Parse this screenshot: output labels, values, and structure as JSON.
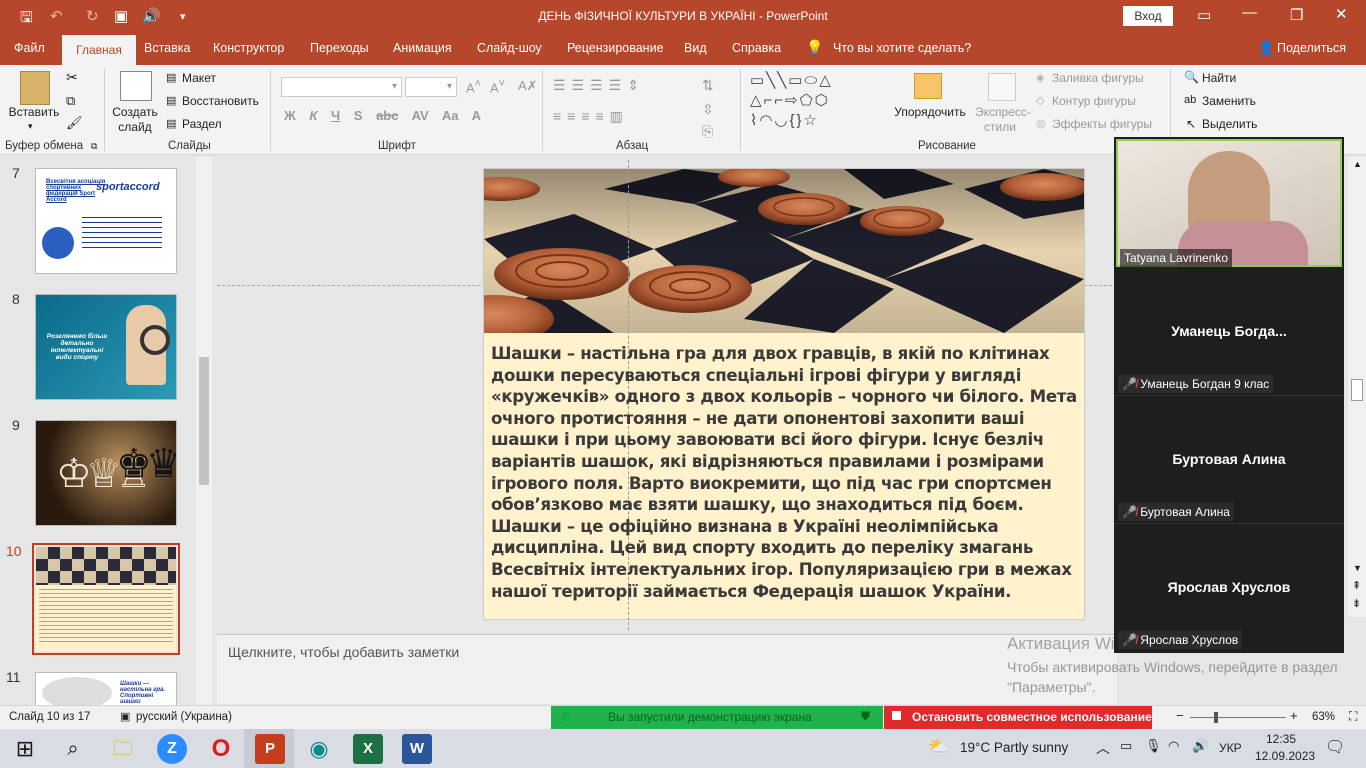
{
  "window": {
    "title": "ДЕНЬ ФІЗИЧНОЇ КУЛЬТУРИ В УКРАЇНІ  -  PowerPoint",
    "signin": "Вход"
  },
  "tabs": [
    "Файл",
    "Главная",
    "Вставка",
    "Конструктор",
    "Переходы",
    "Анимация",
    "Слайд-шоу",
    "Рецензирование",
    "Вид",
    "Справка"
  ],
  "tell_me": "Что вы хотите сделать?",
  "share": "Поделиться",
  "ribbon": {
    "paste": "Вставить",
    "clipboard": "Буфер обмена",
    "new_slide": "Создать слайд",
    "layout": "Макет",
    "reset": "Восстановить",
    "section": "Раздел",
    "slides": "Слайды",
    "font": "Шрифт",
    "paragraph": "Абзац",
    "arrange": "Упорядочить",
    "quick_styles": "Экспресс-стили",
    "shape_fill": "Заливка фигуры",
    "shape_outline": "Контур фигуры",
    "shape_effects": "Эффекты фигуры",
    "drawing": "Рисование",
    "find": "Найти",
    "replace": "Заменить",
    "select": "Выделить",
    "font_buttons": [
      "Ж",
      "К",
      "Ч",
      "S",
      "abc",
      "AV",
      "Aa",
      "A"
    ]
  },
  "thumbnails": [
    {
      "num": "7",
      "text_lines": [
        "Всесвітня асоціація спортивних федерацій Sport Accord"
      ],
      "logo": "sportaccord"
    },
    {
      "num": "8",
      "caption": "Розглянемо більш детально інтелектуальні види спорту"
    },
    {
      "num": "9"
    },
    {
      "num": "10"
    },
    {
      "num": "11",
      "caption": "Шашки — настільна гра. Спортивні шашки"
    }
  ],
  "slide": {
    "paragraph1": "Шашки – настільна гра для двох гравців, в якій по клітинах дошки пересуваються спеціальні ігрові фігури у вигляді «кружечків» одного з двох кольорів – чорного чи білого. Мета очного протистояння – не дати опонентові захопити ваші шашки і при цьому завоювати всі його фігури. Існує безліч варіантів шашок, які відрізняються правилами і розмірами ігрового поля. Варто виокремити, що під час гри спортсмен обов’язково має взяти шашку, що знаходиться під боєм.",
    "paragraph2": "Шашки – це офіційно визнана в Україні неолімпійська дисципліна. Цей вид спорту входить до переліку змагань Всесвітніх інтелектуальних ігор. Популяризацією гри в межах нашої території займається Федерація шашок України."
  },
  "notes_placeholder": "Щелкните, чтобы добавить заметки",
  "watermark": {
    "title": "Активация Windows",
    "line": "Чтобы активировать Windows, перейдите в раздел \"Параметры\"."
  },
  "status": {
    "slide_counter": "Слайд 10 из 17",
    "language": "русский (Украина)",
    "sharing": "Вы запустили демонстрацию экрана",
    "stop_share": "Остановить совместное использование",
    "zoom": "63%"
  },
  "participants": [
    {
      "name": "Tatyana Lavrinenko",
      "video": true
    },
    {
      "name": "Уманець  Богда...",
      "tag": "Уманець Богдан 9 клас"
    },
    {
      "name": "Буртовая Алина",
      "tag": "Буртовая Алина"
    },
    {
      "name": "Ярослав Хруслов",
      "tag": "Ярослав Хруслов"
    }
  ],
  "taskbar": {
    "weather": "19°C  Partly sunny",
    "lang": "УКР",
    "time": "12:35",
    "date": "12.09.2023"
  },
  "colors": {
    "accent": "#b7472a",
    "slide_bg": "#fff2cc",
    "share_green": "#21b24b",
    "stop_red": "#e02b2b"
  }
}
